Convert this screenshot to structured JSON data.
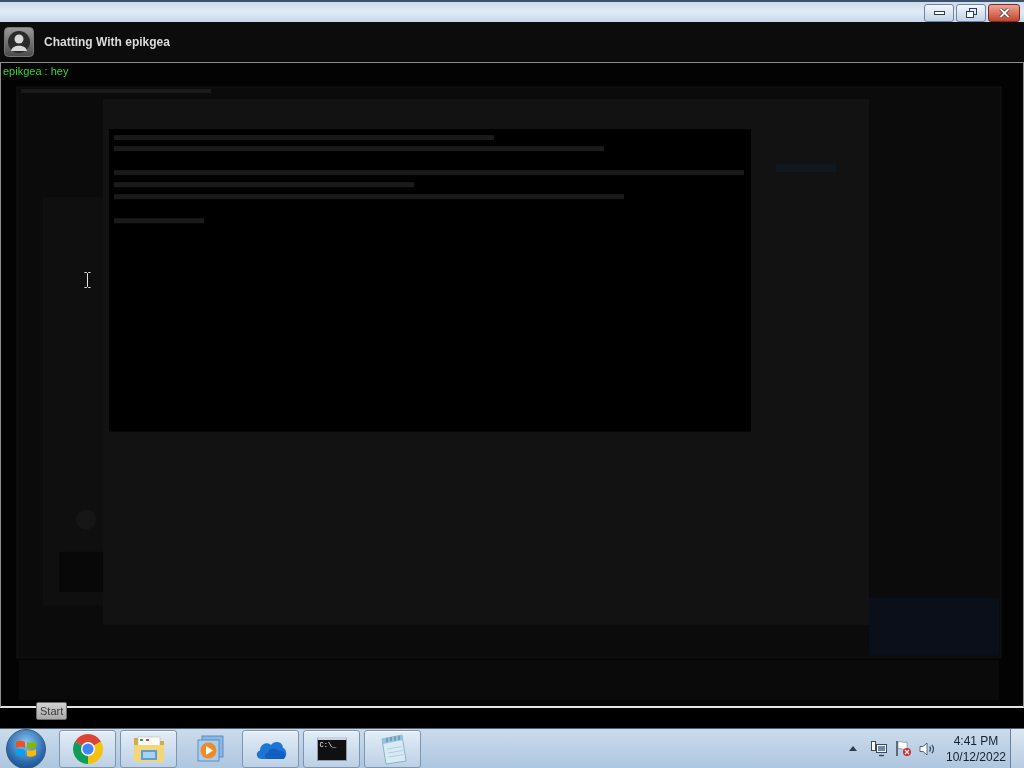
{
  "window": {
    "controls": [
      {
        "kind": "minimize"
      },
      {
        "kind": "restore"
      },
      {
        "kind": "close"
      }
    ]
  },
  "chat": {
    "title": "Chatting With epikgea",
    "messages": [
      {
        "text": "epikgea : hey"
      }
    ]
  },
  "tooltip": {
    "text": "Start"
  },
  "taskbar": {
    "items": [
      {
        "kind": "chrome",
        "running": true
      },
      {
        "kind": "explorer",
        "running": true
      },
      {
        "kind": "media-player",
        "running": false
      },
      {
        "kind": "onedrive",
        "running": true
      },
      {
        "kind": "console",
        "running": true,
        "label": "C:\\_"
      },
      {
        "kind": "notepad",
        "running": true
      }
    ],
    "tray": {
      "icons": [
        {
          "kind": "network",
          "alert": false
        },
        {
          "kind": "action-center",
          "alert": true
        },
        {
          "kind": "volume",
          "alert": false
        }
      ],
      "clock": {
        "time": "4:41 PM",
        "date": "10/12/2022"
      }
    }
  }
}
